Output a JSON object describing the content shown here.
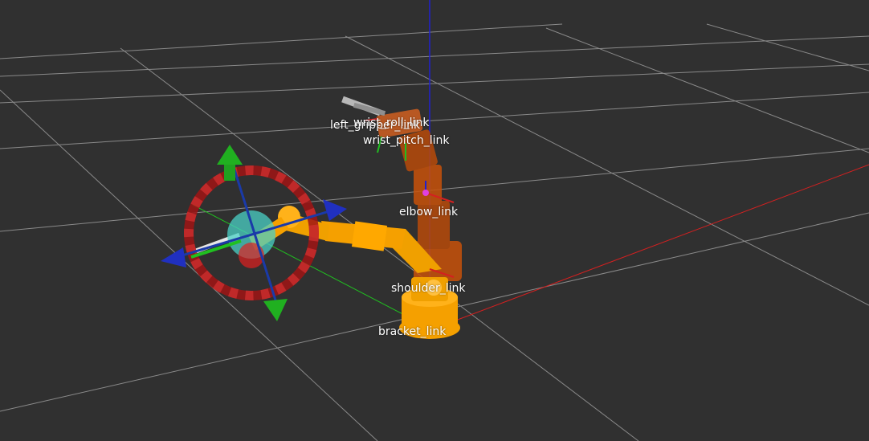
{
  "viewport": {
    "background": "#303030",
    "grid_color": "#a0a0a0"
  },
  "axes": {
    "x_color": "#d42020",
    "y_color": "#20c020",
    "z_color": "#2020d0"
  },
  "robot": {
    "current_color": "#c8520a",
    "goal_color": "#f5a000"
  },
  "marker": {
    "ring_color": "#a01414",
    "ring_stripe": "#d43030",
    "sphere_color": "#49d0c6"
  },
  "frame_labels": {
    "left_gripper": "left_gripper_link",
    "wrist_roll": "wrist_roll_link",
    "wrist_pitch": "wrist_pitch_link",
    "elbow": "elbow_link",
    "shoulder": "shoulder_link",
    "bracket": "bracket_link"
  }
}
